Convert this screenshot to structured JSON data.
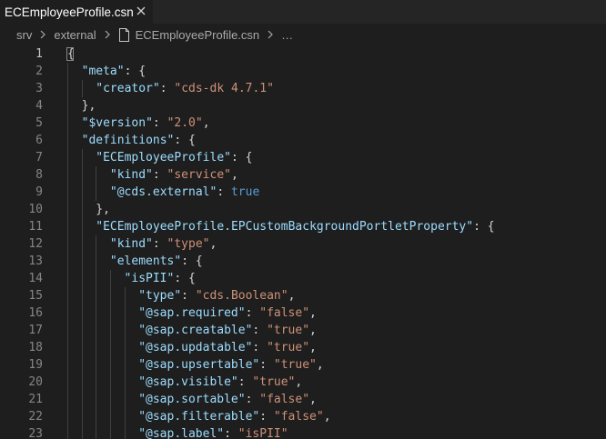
{
  "tab": {
    "title": "ECEmployeeProfile.csn",
    "close_icon": "close-icon"
  },
  "breadcrumb": {
    "items": [
      "srv",
      "external",
      "ECEmployeeProfile.csn",
      "…"
    ],
    "separator_icon": "chevron-right-icon",
    "file_icon": "json-file-icon"
  },
  "editor": {
    "active_line": 1,
    "lines": [
      {
        "n": "1",
        "indent": 0,
        "t": [
          [
            "p",
            "{"
          ]
        ]
      },
      {
        "n": "2",
        "indent": 1,
        "t": [
          [
            "k",
            "\"meta\""
          ],
          [
            "p",
            ": {"
          ]
        ]
      },
      {
        "n": "3",
        "indent": 2,
        "t": [
          [
            "k",
            "\"creator\""
          ],
          [
            "p",
            ": "
          ],
          [
            "s",
            "\"cds-dk 4.7.1\""
          ]
        ]
      },
      {
        "n": "4",
        "indent": 1,
        "t": [
          [
            "p",
            "},"
          ]
        ]
      },
      {
        "n": "5",
        "indent": 1,
        "t": [
          [
            "k",
            "\"$version\""
          ],
          [
            "p",
            ": "
          ],
          [
            "s",
            "\"2.0\""
          ],
          [
            "p",
            ","
          ]
        ]
      },
      {
        "n": "6",
        "indent": 1,
        "t": [
          [
            "k",
            "\"definitions\""
          ],
          [
            "p",
            ": {"
          ]
        ]
      },
      {
        "n": "7",
        "indent": 2,
        "t": [
          [
            "k",
            "\"ECEmployeeProfile\""
          ],
          [
            "p",
            ": {"
          ]
        ]
      },
      {
        "n": "8",
        "indent": 3,
        "t": [
          [
            "k",
            "\"kind\""
          ],
          [
            "p",
            ": "
          ],
          [
            "s",
            "\"service\""
          ],
          [
            "p",
            ","
          ]
        ]
      },
      {
        "n": "9",
        "indent": 3,
        "t": [
          [
            "k",
            "\"@cds.external\""
          ],
          [
            "p",
            ": "
          ],
          [
            "b",
            "true"
          ]
        ]
      },
      {
        "n": "10",
        "indent": 2,
        "t": [
          [
            "p",
            "},"
          ]
        ]
      },
      {
        "n": "11",
        "indent": 2,
        "t": [
          [
            "k",
            "\"ECEmployeeProfile.EPCustomBackgroundPortletProperty\""
          ],
          [
            "p",
            ": {"
          ]
        ]
      },
      {
        "n": "12",
        "indent": 3,
        "t": [
          [
            "k",
            "\"kind\""
          ],
          [
            "p",
            ": "
          ],
          [
            "s",
            "\"type\""
          ],
          [
            "p",
            ","
          ]
        ]
      },
      {
        "n": "13",
        "indent": 3,
        "t": [
          [
            "k",
            "\"elements\""
          ],
          [
            "p",
            ": {"
          ]
        ]
      },
      {
        "n": "14",
        "indent": 4,
        "t": [
          [
            "k",
            "\"isPII\""
          ],
          [
            "p",
            ": {"
          ]
        ]
      },
      {
        "n": "15",
        "indent": 5,
        "t": [
          [
            "k",
            "\"type\""
          ],
          [
            "p",
            ": "
          ],
          [
            "s",
            "\"cds.Boolean\""
          ],
          [
            "p",
            ","
          ]
        ]
      },
      {
        "n": "16",
        "indent": 5,
        "t": [
          [
            "k",
            "\"@sap.required\""
          ],
          [
            "p",
            ": "
          ],
          [
            "s",
            "\"false\""
          ],
          [
            "p",
            ","
          ]
        ]
      },
      {
        "n": "17",
        "indent": 5,
        "t": [
          [
            "k",
            "\"@sap.creatable\""
          ],
          [
            "p",
            ": "
          ],
          [
            "s",
            "\"true\""
          ],
          [
            "p",
            ","
          ]
        ]
      },
      {
        "n": "18",
        "indent": 5,
        "t": [
          [
            "k",
            "\"@sap.updatable\""
          ],
          [
            "p",
            ": "
          ],
          [
            "s",
            "\"true\""
          ],
          [
            "p",
            ","
          ]
        ]
      },
      {
        "n": "19",
        "indent": 5,
        "t": [
          [
            "k",
            "\"@sap.upsertable\""
          ],
          [
            "p",
            ": "
          ],
          [
            "s",
            "\"true\""
          ],
          [
            "p",
            ","
          ]
        ]
      },
      {
        "n": "20",
        "indent": 5,
        "t": [
          [
            "k",
            "\"@sap.visible\""
          ],
          [
            "p",
            ": "
          ],
          [
            "s",
            "\"true\""
          ],
          [
            "p",
            ","
          ]
        ]
      },
      {
        "n": "21",
        "indent": 5,
        "t": [
          [
            "k",
            "\"@sap.sortable\""
          ],
          [
            "p",
            ": "
          ],
          [
            "s",
            "\"false\""
          ],
          [
            "p",
            ","
          ]
        ]
      },
      {
        "n": "22",
        "indent": 5,
        "t": [
          [
            "k",
            "\"@sap.filterable\""
          ],
          [
            "p",
            ": "
          ],
          [
            "s",
            "\"false\""
          ],
          [
            "p",
            ","
          ]
        ]
      },
      {
        "n": "23",
        "indent": 5,
        "t": [
          [
            "k",
            "\"@sap.label\""
          ],
          [
            "p",
            ": "
          ],
          [
            "s",
            "\"isPII\""
          ]
        ]
      }
    ]
  }
}
